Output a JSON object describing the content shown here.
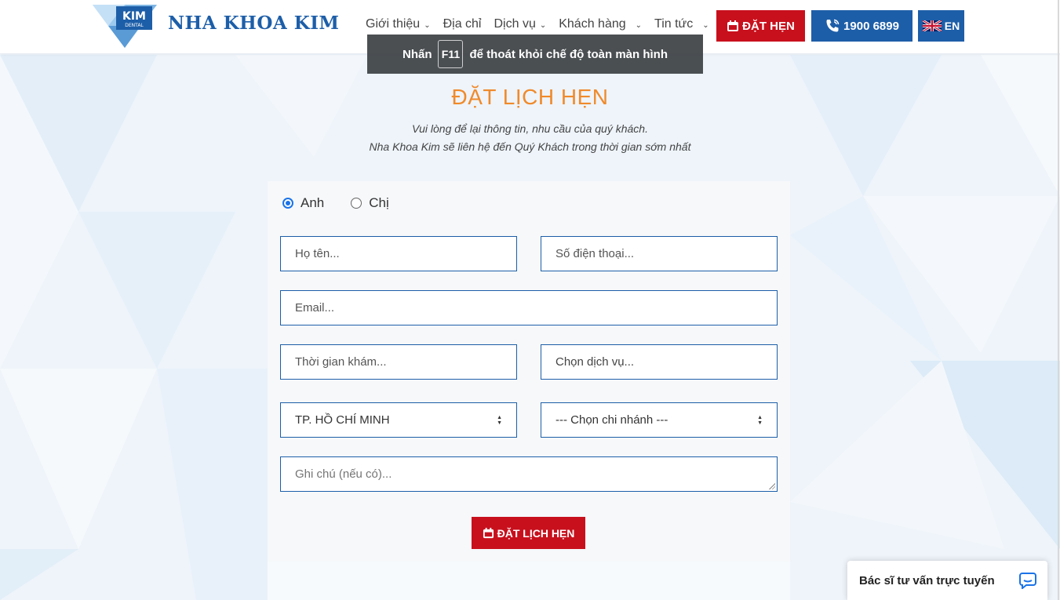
{
  "header": {
    "logo_text": "KIM",
    "logo_subtext": "DENTAL",
    "brand": "NHA KHOA KIM",
    "nav": [
      {
        "label": "Giới thiệu",
        "has_dropdown": true
      },
      {
        "label": "Địa chỉ",
        "has_dropdown": false
      },
      {
        "label": "Dịch vụ",
        "has_dropdown": true
      },
      {
        "label": "Khách hàng",
        "has_dropdown": true
      },
      {
        "label": "Tin tức",
        "has_dropdown": true
      }
    ],
    "book_button": "ĐẶT HẸN",
    "phone_button": "1900 6899",
    "lang_button": "EN"
  },
  "fullscreen_notice": {
    "prefix": "Nhấn",
    "key": "F11",
    "suffix": "để thoát khỏi chế độ toàn màn hình"
  },
  "page": {
    "title": "ĐẶT LỊCH HẸN",
    "subtitle_line1": "Vui lòng để lại thông tin, nhu cầu của quý khách.",
    "subtitle_line2": "Nha Khoa Kim sẽ liên hệ đến Quý Khách trong thời gian sớm nhất"
  },
  "form": {
    "salutation_options": [
      {
        "label": "Anh",
        "checked": true
      },
      {
        "label": "Chị",
        "checked": false
      }
    ],
    "name_placeholder": "Họ tên...",
    "phone_placeholder": "Số điện thoại...",
    "email_placeholder": "Email...",
    "time_placeholder": "Thời gian khám...",
    "service_label": "Chọn dịch vụ...",
    "city_selected": "TP. HỒ CHÍ MINH",
    "branch_selected": "--- Chọn chi nhánh ---",
    "note_placeholder": "Ghi chú (nếu có)...",
    "submit_label": "ĐẶT LỊCH HẸN"
  },
  "chat": {
    "label": "Bác sĩ tư vấn trực tuyến"
  },
  "colors": {
    "brand_blue": "#1d5ea8",
    "accent_red": "#c8101d",
    "title_orange": "#f08a2b",
    "radio_blue": "#1a73e8"
  }
}
